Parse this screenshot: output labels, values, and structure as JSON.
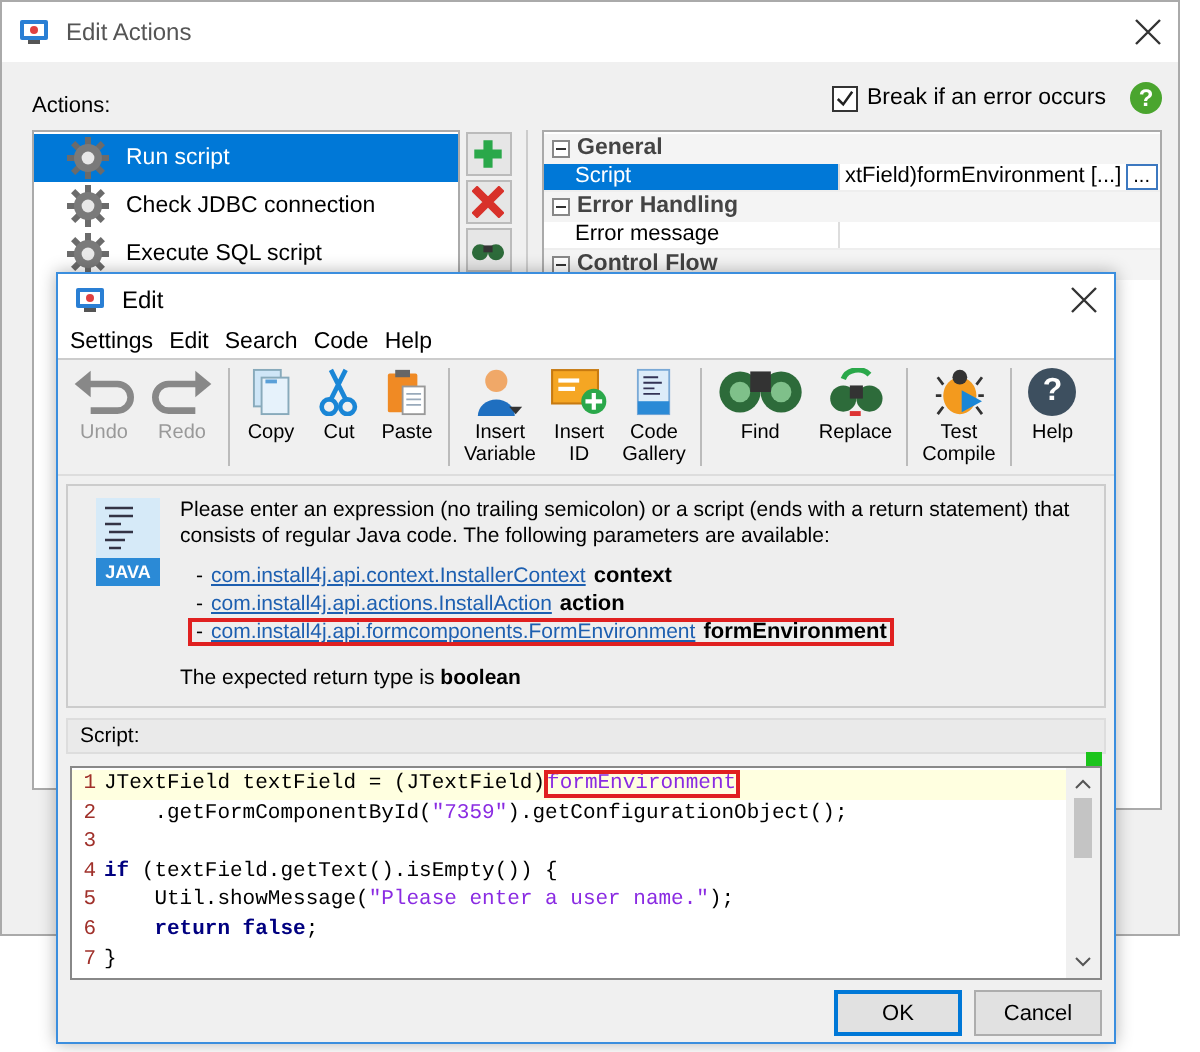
{
  "window": {
    "title": "Edit Actions",
    "actions_label": "Actions:",
    "break_on_error": {
      "label": "Break if an error occurs",
      "checked": true
    },
    "help_glyph": "?",
    "actions": [
      {
        "label": "Run script",
        "selected": true
      },
      {
        "label": "Check JDBC connection",
        "selected": false
      },
      {
        "label": "Execute SQL script",
        "selected": false
      }
    ],
    "action_buttons": [
      {
        "kind": "add"
      },
      {
        "kind": "remove"
      },
      {
        "kind": "find"
      }
    ],
    "properties": [
      {
        "category": "General",
        "expanded": true,
        "rows": [
          {
            "name": "Script",
            "value": "xtField)formEnvironment [...]",
            "button": "...",
            "selected": true
          }
        ]
      },
      {
        "category": "Error Handling",
        "expanded": true,
        "rows": [
          {
            "name": "Error message",
            "selected": false
          }
        ]
      },
      {
        "category": "Control Flow",
        "expanded": true
      }
    ]
  },
  "dialog": {
    "title": "Edit",
    "menu": [
      "Settings",
      "Edit",
      "Search",
      "Code",
      "Help"
    ],
    "toolbar": [
      [
        {
          "kind": "undo",
          "label": "Undo",
          "disabled": true
        },
        {
          "kind": "redo",
          "label": "Redo",
          "disabled": true
        }
      ],
      [
        {
          "kind": "copy",
          "label": "Copy",
          "disabled": false
        },
        {
          "kind": "cut",
          "label": "Cut",
          "disabled": false
        },
        {
          "kind": "paste",
          "label": "Paste",
          "disabled": false
        }
      ],
      [
        {
          "kind": "variable",
          "label": "Insert Variable",
          "disabled": false
        },
        {
          "kind": "id",
          "label": "Insert ID",
          "disabled": false
        },
        {
          "kind": "gallery",
          "label": "Code Gallery",
          "disabled": false
        }
      ],
      [
        {
          "kind": "find",
          "label": "Find",
          "disabled": false
        },
        {
          "kind": "replace",
          "label": "Replace",
          "disabled": false
        }
      ],
      [
        {
          "kind": "compile",
          "label": "Test Compile",
          "disabled": false
        }
      ],
      [
        {
          "kind": "help",
          "label": "Help",
          "glyph": "?",
          "disabled": false
        }
      ]
    ],
    "info": {
      "icon_label": "JAVA",
      "text": "Please enter an expression (no trailing semicolon) or a script (ends with a return statement) that consists of regular Java code. The following parameters are available:",
      "parameters": [
        {
          "bullet": "-",
          "type": "com.install4j.api.context.InstallerContext",
          "name": "context",
          "highlighted": false
        },
        {
          "bullet": "-",
          "type": "com.install4j.api.actions.InstallAction",
          "name": "action",
          "highlighted": false
        },
        {
          "bullet": "-",
          "type": "com.install4j.api.formcomponents.FormEnvironment",
          "name": "formEnvironment",
          "highlighted": true
        }
      ],
      "return_text": "The expected return type is **boolean**"
    },
    "script_label": "Script:",
    "code": [
      {
        "number": "1",
        "current": true,
        "tokens": [
          {
            "kind": "plain",
            "text": "JTextField textField = (JTextField)"
          },
          {
            "kind": "marked",
            "text": "formEnvironment"
          }
        ]
      },
      {
        "number": "2",
        "current": false,
        "tokens": [
          {
            "kind": "plain",
            "text": "    .getFormComponentById("
          },
          {
            "kind": "string",
            "text": "\"7359\""
          },
          {
            "kind": "plain",
            "text": ").getConfigurationObject();"
          }
        ]
      },
      {
        "number": "3",
        "current": false
      },
      {
        "number": "4",
        "current": false,
        "tokens": [
          {
            "kind": "keyword",
            "text": "if"
          },
          {
            "kind": "plain",
            "text": " (textField.getText().isEmpty()) {"
          }
        ]
      },
      {
        "number": "5",
        "current": false,
        "tokens": [
          {
            "kind": "plain",
            "text": "    Util.showMessage("
          },
          {
            "kind": "string",
            "text": "\"Please enter a user name.\""
          },
          {
            "kind": "plain",
            "text": ");"
          }
        ]
      },
      {
        "number": "6",
        "current": false,
        "tokens": [
          {
            "kind": "keyword",
            "text": "    return false"
          },
          {
            "kind": "plain",
            "text": ";"
          }
        ]
      },
      {
        "number": "7",
        "current": false,
        "tokens": [
          {
            "kind": "plain",
            "text": "}"
          }
        ]
      }
    ],
    "buttons": [
      {
        "label": "OK",
        "default": true
      },
      {
        "label": "Cancel",
        "default": false
      }
    ]
  }
}
